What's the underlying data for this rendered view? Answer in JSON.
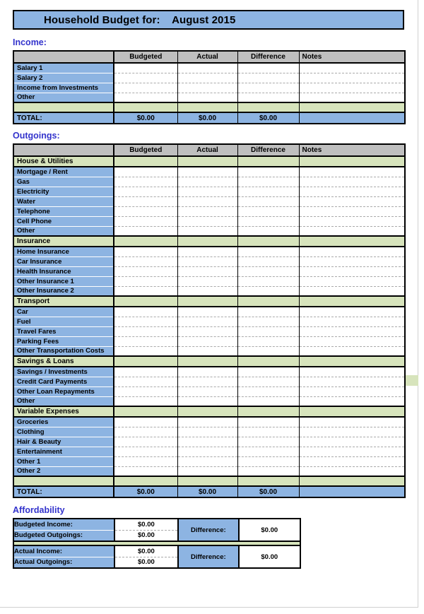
{
  "title": {
    "label": "Household Budget for:",
    "period": "August 2015",
    "full": "Household Budget for:    August 2015"
  },
  "columns": {
    "label": "",
    "budgeted": "Budgeted",
    "actual": "Actual",
    "difference": "Difference",
    "notes": "Notes"
  },
  "income": {
    "heading": "Income:",
    "rows": [
      {
        "label": "Salary 1"
      },
      {
        "label": "Salary 2"
      },
      {
        "label": "Income from Investments"
      },
      {
        "label": "Other"
      }
    ],
    "total": {
      "label": "TOTAL:",
      "budgeted": "$0.00",
      "actual": "$0.00",
      "difference": "$0.00",
      "notes": ""
    }
  },
  "outgoings": {
    "heading": "Outgoings:",
    "groups": [
      {
        "name": "House & Utilities",
        "rows": [
          {
            "label": "Mortgage / Rent"
          },
          {
            "label": "Gas"
          },
          {
            "label": "Electricity"
          },
          {
            "label": "Water"
          },
          {
            "label": "Telephone"
          },
          {
            "label": "Cell Phone"
          },
          {
            "label": "Other"
          }
        ]
      },
      {
        "name": "Insurance",
        "rows": [
          {
            "label": "Home Insurance"
          },
          {
            "label": "Car Insurance"
          },
          {
            "label": "Health Insurance"
          },
          {
            "label": "Other Insurance 1"
          },
          {
            "label": "Other Insurance 2"
          }
        ]
      },
      {
        "name": "Transport",
        "rows": [
          {
            "label": "Car"
          },
          {
            "label": "Fuel"
          },
          {
            "label": "Travel Fares"
          },
          {
            "label": "Parking Fees"
          },
          {
            "label": "Other Transportation Costs"
          }
        ]
      },
      {
        "name": "Savings & Loans",
        "rows": [
          {
            "label": "Savings / Investments"
          },
          {
            "label": "Credit Card Payments"
          },
          {
            "label": "Other Loan Repayments"
          },
          {
            "label": "Other"
          }
        ]
      },
      {
        "name": "Variable Expenses",
        "rows": [
          {
            "label": "Groceries"
          },
          {
            "label": "Clothing"
          },
          {
            "label": "Hair & Beauty"
          },
          {
            "label": "Entertainment"
          },
          {
            "label": "Other 1"
          },
          {
            "label": "Other 2"
          }
        ]
      }
    ],
    "total": {
      "label": "TOTAL:",
      "budgeted": "$0.00",
      "actual": "$0.00",
      "difference": "$0.00",
      "notes": ""
    }
  },
  "affordability": {
    "heading": "Affordability",
    "budgeted": {
      "income_label": "Budgeted Income:",
      "income_value": "$0.00",
      "outgoings_label": "Budgeted Outgoings:",
      "outgoings_value": "$0.00",
      "difference_label": "Difference:",
      "difference_value": "$0.00"
    },
    "actual": {
      "income_label": "Actual Income:",
      "income_value": "$0.00",
      "outgoings_label": "Actual Outgoings:",
      "outgoings_value": "$0.00",
      "difference_label": "Difference:",
      "difference_value": "$0.00"
    }
  },
  "colors": {
    "header_blue": "#8DB4E2",
    "category_green": "#D7E4BC",
    "column_header_grey": "#BFBFBF",
    "heading_blue": "#3333CC",
    "positive_green": "#009900",
    "border_black": "#000000"
  }
}
